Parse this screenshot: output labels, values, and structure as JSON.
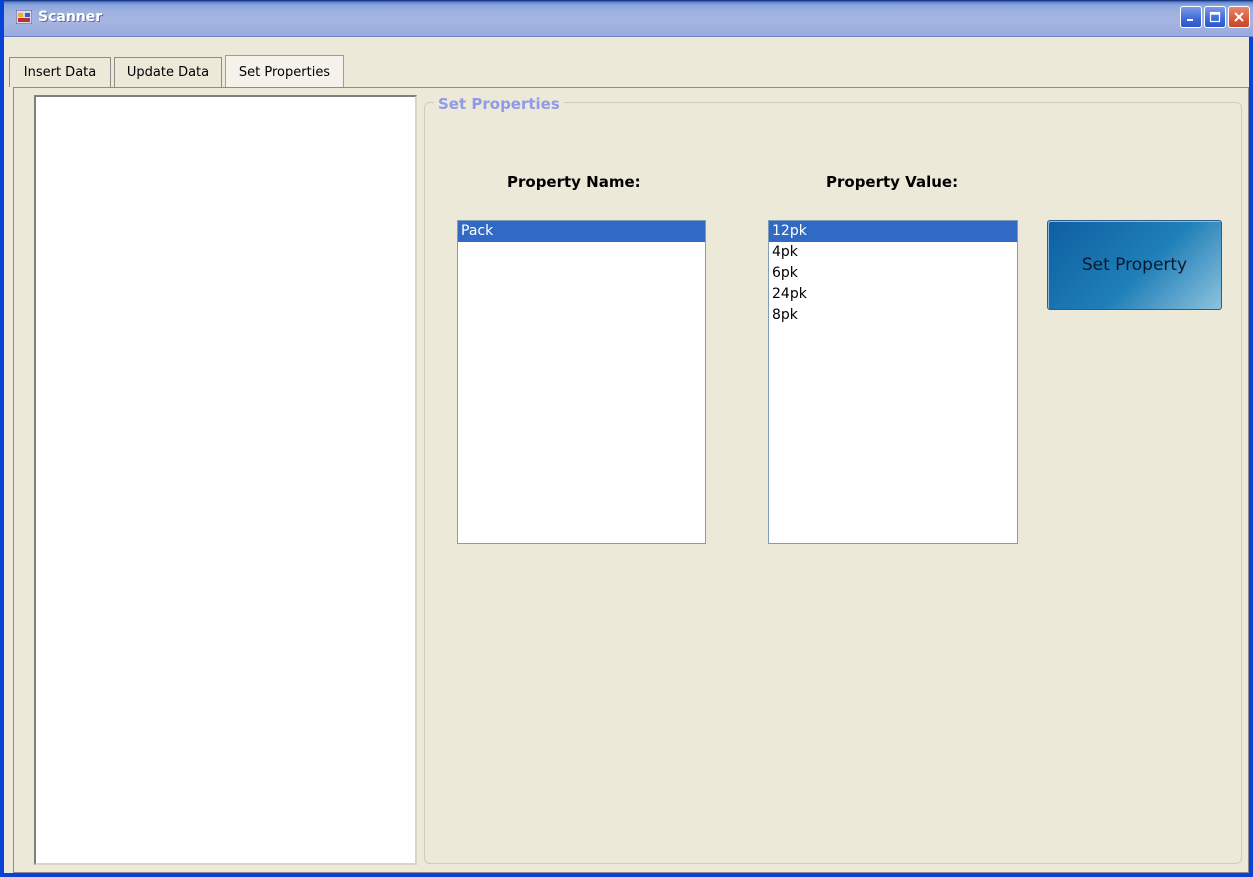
{
  "window": {
    "title": "Scanner"
  },
  "tabs": [
    {
      "label": "Insert Data"
    },
    {
      "label": "Update Data"
    },
    {
      "label": "Set Properties"
    }
  ],
  "group": {
    "legend": "Set Properties"
  },
  "labels": {
    "property_name": "Property Name:",
    "property_value": "Property Value:"
  },
  "property_names": {
    "items": [
      "Pack"
    ],
    "selected": "Pack"
  },
  "property_values": {
    "items": [
      "12pk",
      "4pk",
      "6pk",
      "24pk",
      "8pk"
    ],
    "selected": "12pk"
  },
  "set_property_button": {
    "label": "Set Property"
  },
  "colors": {
    "title_bar": "#a6b5e0",
    "selection": "#316ac5",
    "legend_text": "#8f9ae8",
    "button_gradient_start": "#0e5fa0"
  }
}
